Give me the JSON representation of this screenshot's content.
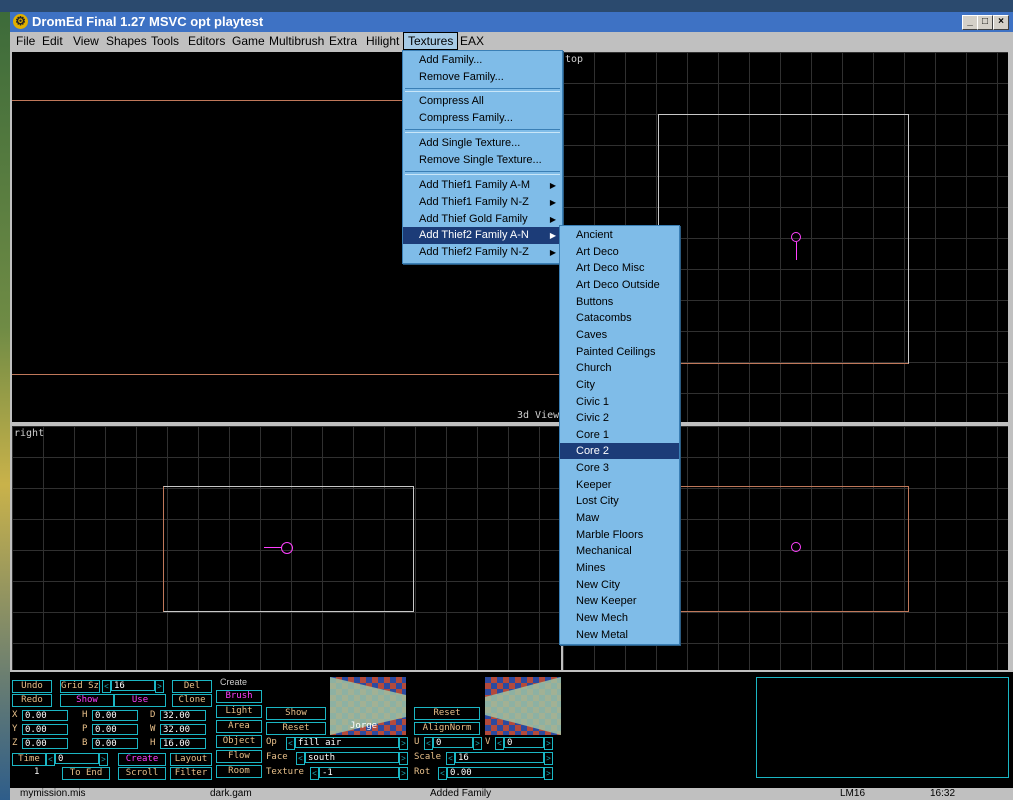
{
  "window": {
    "title": "DromEd Final 1.27 MSVC opt playtest"
  },
  "menubar": [
    "File",
    "Edit",
    "View",
    "Shapes",
    "Tools",
    "Editors",
    "Game",
    "Multibrush",
    "Extra",
    "Hilight",
    "Textures",
    "EAX"
  ],
  "textures_menu": {
    "items": [
      "Add Family...",
      "Remove Family...",
      "Compress All",
      "Compress Family...",
      "Add Single Texture...",
      "Remove Single Texture...",
      "Add Thief1 Family A-M",
      "Add Thief1 Family N-Z",
      "Add Thief Gold Family",
      "Add Thief2 Family A-N",
      "Add Thief2 Family N-Z"
    ],
    "selected": "Add Thief2 Family A-N"
  },
  "families_menu": {
    "items": [
      "Ancient",
      "Art Deco",
      "Art Deco Misc",
      "Art Deco Outside",
      "Buttons",
      "Catacombs",
      "Caves",
      "Painted Ceilings",
      "Church",
      "City",
      "Civic 1",
      "Civic 2",
      "Core 1",
      "Core 2",
      "Core 3",
      "Keeper",
      "Lost City",
      "Maw",
      "Marble Floors",
      "Mechanical",
      "Mines",
      "New City",
      "New Keeper",
      "New Mech",
      "New Metal"
    ],
    "selected": "Core 2"
  },
  "views": {
    "view3d": "3d View",
    "top": "top",
    "right": "right"
  },
  "panel": {
    "undo": "Undo",
    "redo": "Redo",
    "grid_sz": "Grid Sz",
    "grid_val": "16",
    "show": "Show",
    "use": "Use",
    "del": "Del",
    "clone": "Clone",
    "create_label": "Create",
    "brush": "Brush",
    "light": "Light",
    "area": "Area",
    "object": "Object",
    "flow": "Flow",
    "room": "Room",
    "show2": "Show",
    "reset": "Reset",
    "x": "0.00",
    "y": "0.00",
    "z": "0.00",
    "h": "0.00",
    "p": "0.00",
    "b": "0.00",
    "d": "32.00",
    "w": "32.00",
    "hh": "16.00",
    "time": "Time",
    "time_val": "0",
    "frame": "1",
    "to_end": "To End",
    "create_btn": "Create",
    "layout": "Layout",
    "scroll": "Scroll",
    "filter": "Filter",
    "op": "Op",
    "op_val": "fill air",
    "face": "Face",
    "face_val": "south",
    "texture": "Texture",
    "texture_val": "-1",
    "tex_name": "Jorge",
    "reset2": "Reset",
    "align_norm": "AlignNorm",
    "u_val": "0",
    "v_val": "0",
    "scale": "Scale",
    "scale_val": "16",
    "rot": "Rot",
    "rot_val": "0.00"
  },
  "status": {
    "file": "mymission.mis",
    "gam": "dark.gam",
    "msg": "Added Family",
    "lm": "LM16",
    "num": "16:32"
  },
  "colors": {
    "grid": "#3a3a3a",
    "brush_line": "#c0785a",
    "selection": "#ff40ff",
    "accent": "#1bb6c4"
  }
}
